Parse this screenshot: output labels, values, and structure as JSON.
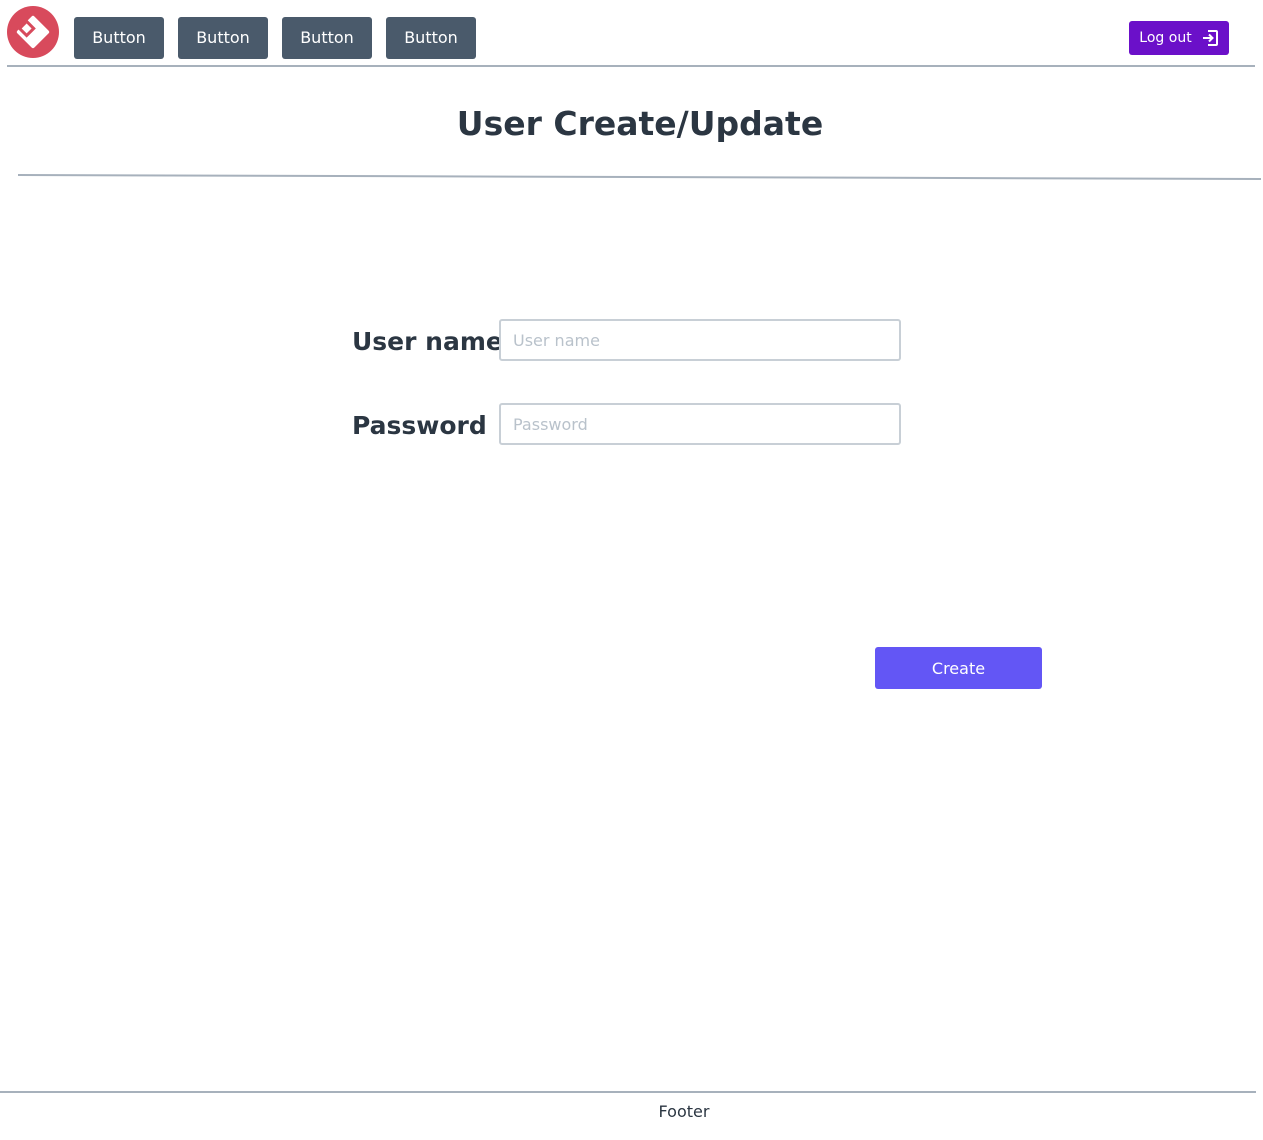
{
  "header": {
    "logo_icon": "diamond-logo-icon",
    "nav_buttons": [
      {
        "label": "Button"
      },
      {
        "label": "Button"
      },
      {
        "label": "Button"
      },
      {
        "label": "Button"
      }
    ],
    "logout": {
      "label": "Log out",
      "icon": "logout-icon"
    }
  },
  "main": {
    "title": "User Create/Update",
    "form": {
      "username": {
        "label": "User name",
        "placeholder": "User name",
        "value": ""
      },
      "password": {
        "label": "Password",
        "placeholder": "Password",
        "value": ""
      },
      "submit_label": "Create"
    }
  },
  "footer": {
    "text": "Footer"
  },
  "colors": {
    "logo": "#d84a5c",
    "nav_button": "#4a5a6b",
    "logout_button": "#6b10c9",
    "create_button": "#6356f5",
    "text": "#2b3642",
    "rule": "#a7b1bc"
  }
}
